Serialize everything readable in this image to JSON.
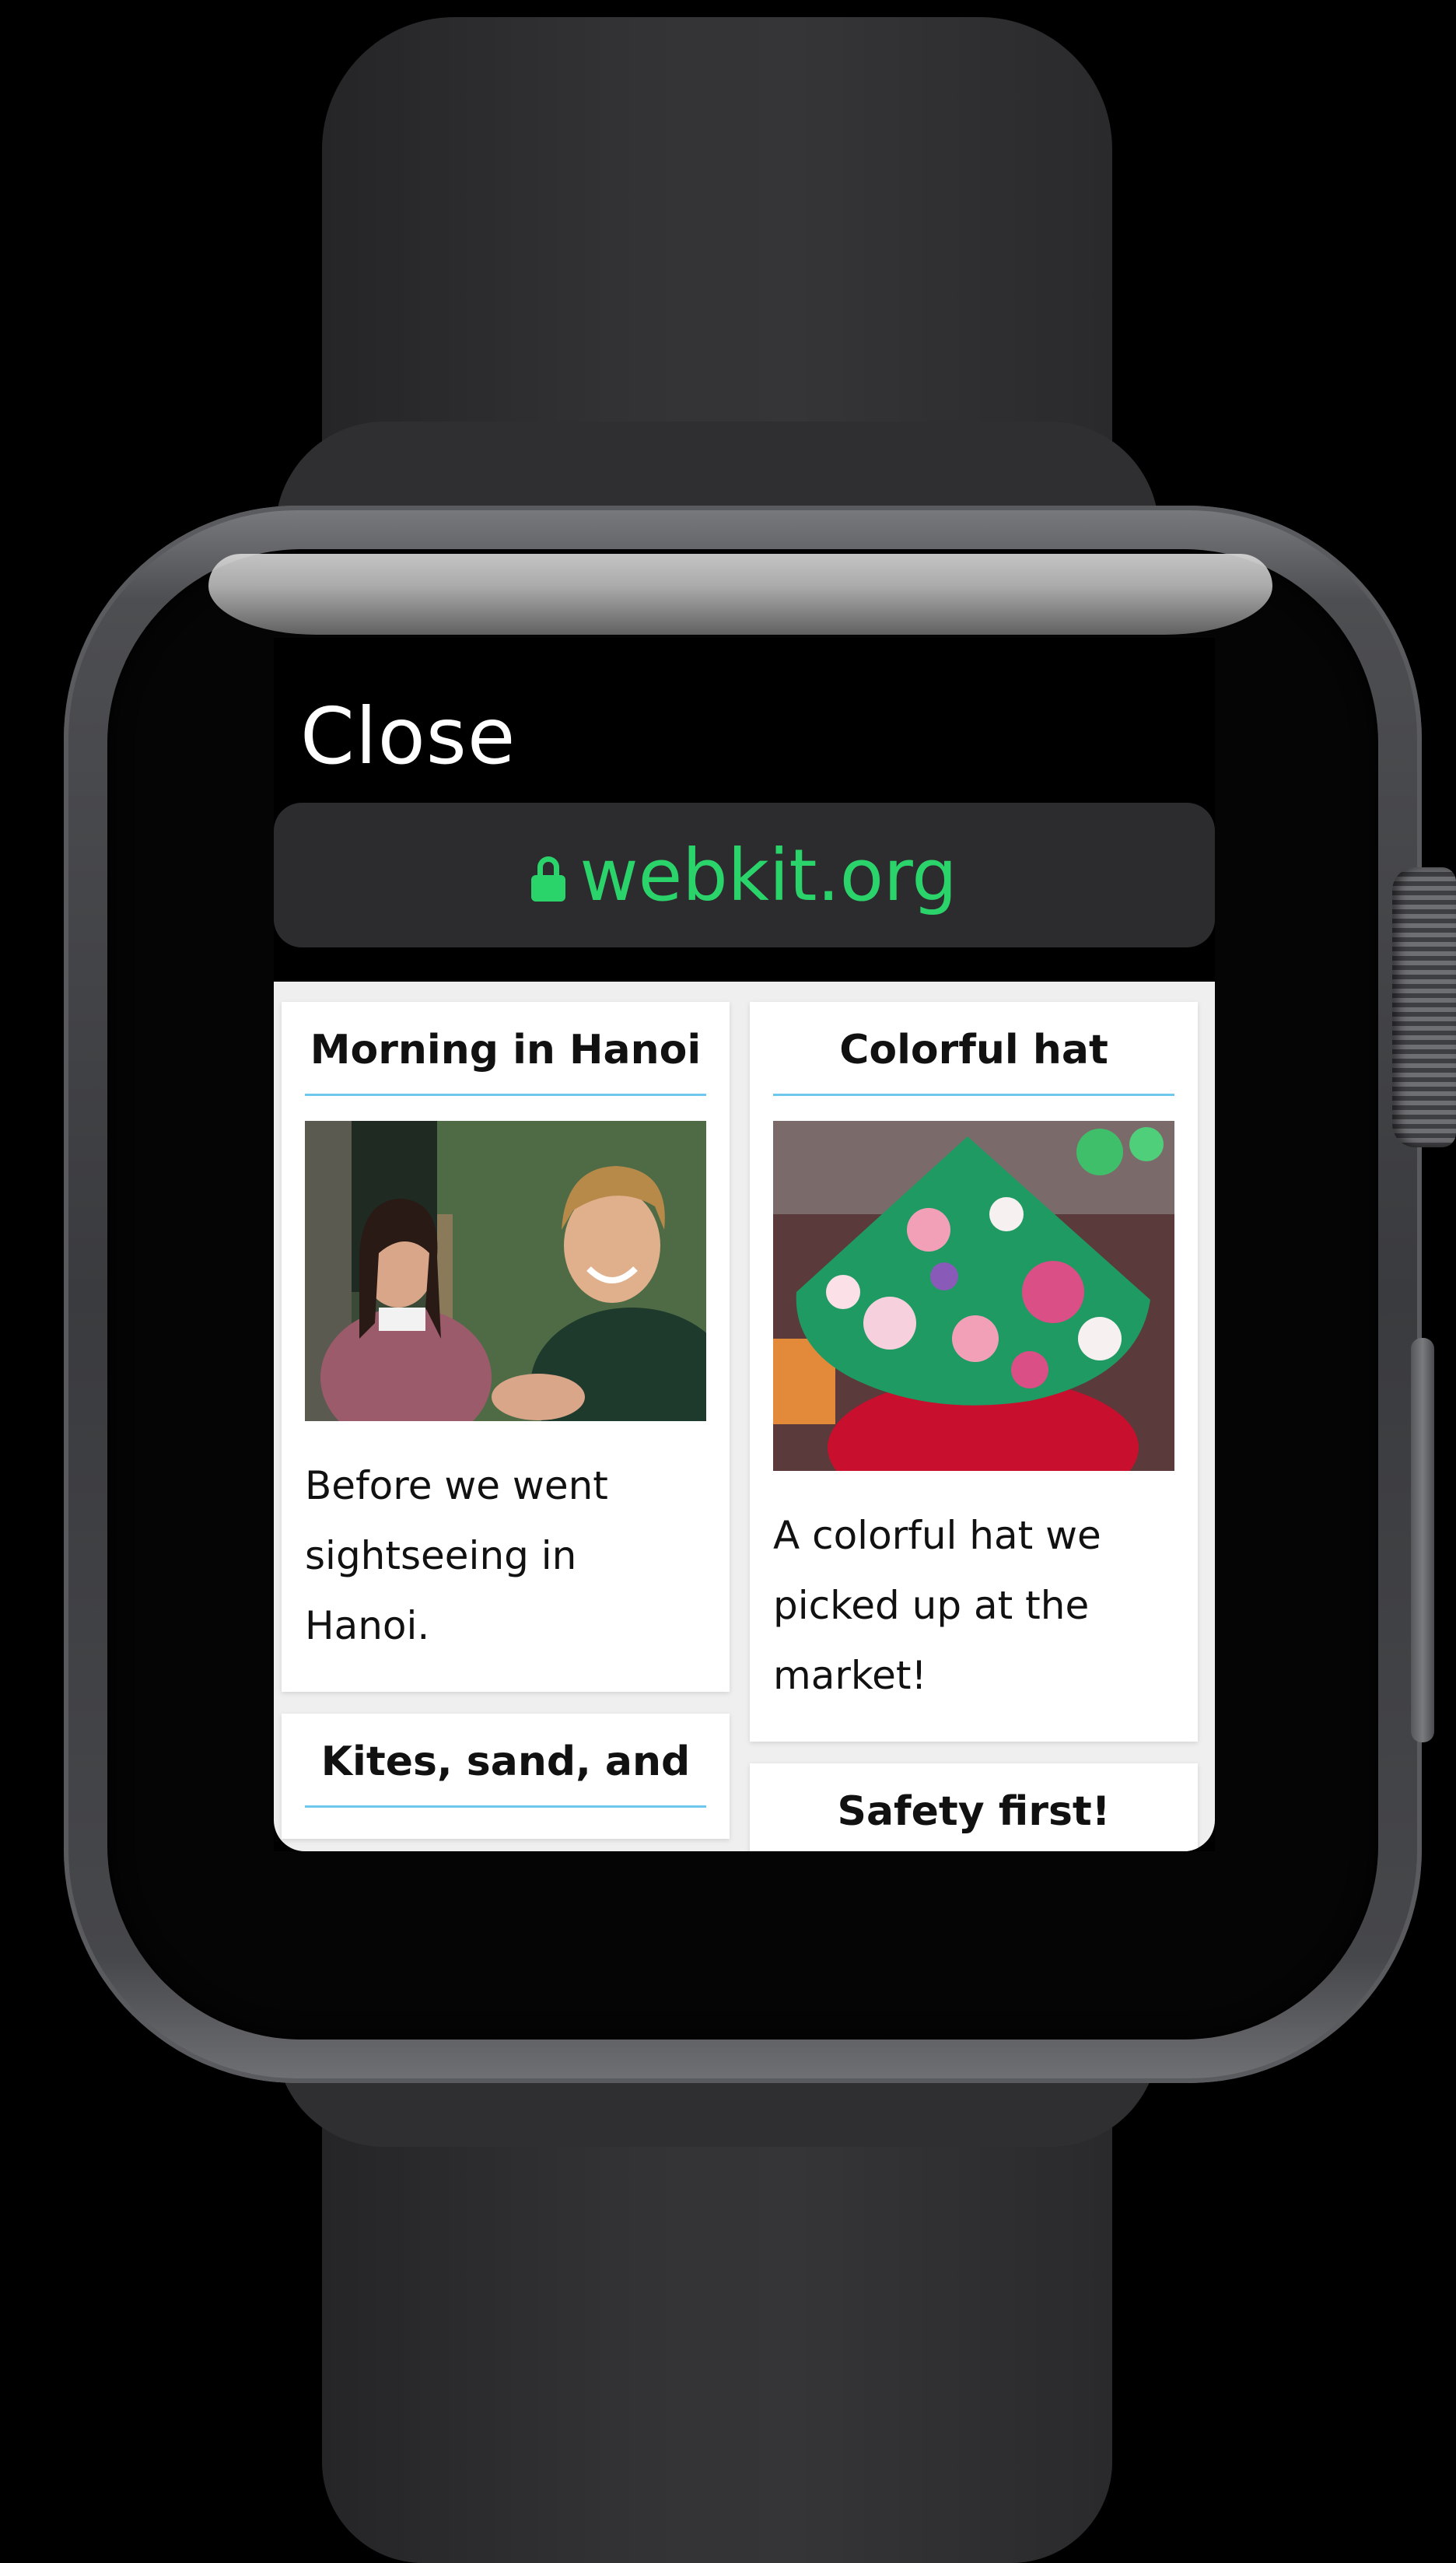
{
  "browser": {
    "close_label": "Close",
    "url": "webkit.org",
    "lock_icon": "lock-icon",
    "url_color": "#2bd46b"
  },
  "cards": {
    "left": [
      {
        "title": "Morning in Hanoi",
        "photo": "two-people-smiling-photo",
        "caption": "Before we went sightseeing in Hanoi."
      },
      {
        "title": "Kites, sand, and",
        "photo": "",
        "caption": ""
      }
    ],
    "right": [
      {
        "title": "Colorful hat",
        "photo": "floral-conical-hat-photo",
        "caption": "A colorful hat we picked up at the market!"
      },
      {
        "title": "Safety first!",
        "photo": "",
        "caption": ""
      }
    ]
  },
  "colors": {
    "title_underline": "#6ec8ee",
    "page_background": "#efefef",
    "url_bar_background": "#2c2c2e"
  }
}
